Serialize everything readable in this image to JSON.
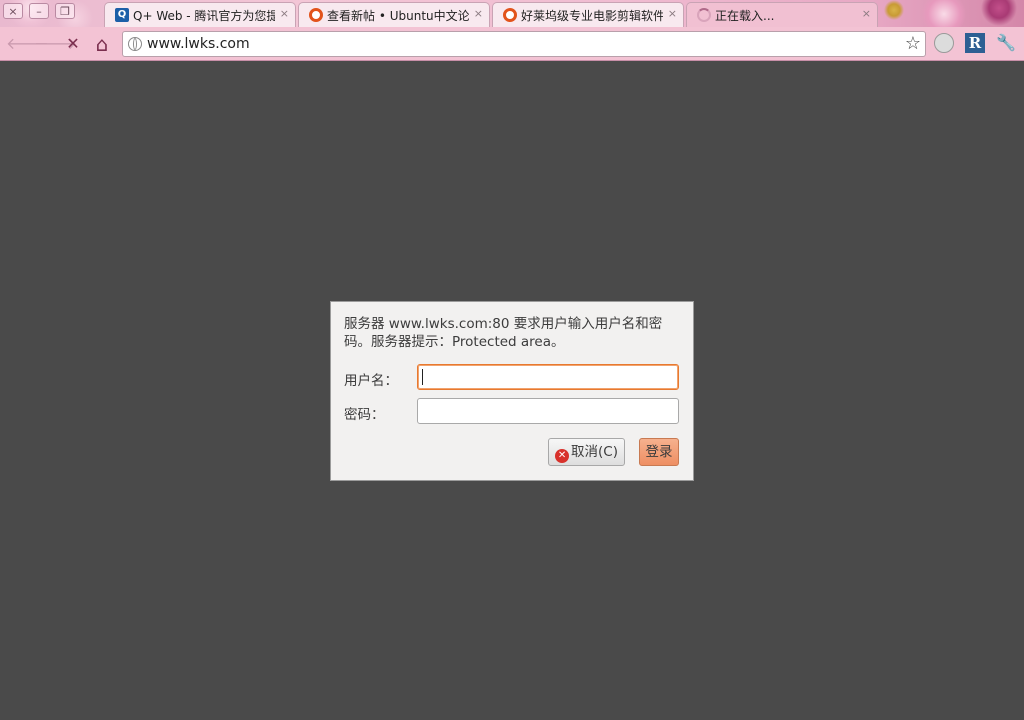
{
  "tabs": [
    {
      "favicon": "q-web-icon",
      "title": "Q+ Web - 腾讯官方为您提供",
      "close": "×"
    },
    {
      "favicon": "ubuntu-icon",
      "title": "查看新帖 • Ubuntu中文论坛",
      "close": "×"
    },
    {
      "favicon": "ubuntu-icon",
      "title": "好莱坞级专业电影剪辑软件",
      "close": "×"
    },
    {
      "favicon": "loading-spinner-icon",
      "title": "正在载入...",
      "close": "×"
    }
  ],
  "window_controls": {
    "close": "×",
    "minimize": "–",
    "restore": "❐"
  },
  "toolbar": {
    "url": "www.lwks.com",
    "icons": {
      "back": "🡐",
      "forward": "🡒",
      "stop": "✕",
      "home": "⌂",
      "star": "☆",
      "ext_r": "R",
      "wrench": "🔧"
    }
  },
  "dialog": {
    "message": "服务器 www.lwks.com:80 要求用户输入用户名和密码。服务器提示：Protected area。",
    "username_label": "用户名：",
    "password_label": "密码：",
    "username_value": "",
    "password_value": "",
    "cancel_label": "取消(C)",
    "login_label": "登录"
  },
  "colors": {
    "accent": "#e8792f",
    "background": "#4a4a4a",
    "theme_pink": "#f3c3d4"
  }
}
